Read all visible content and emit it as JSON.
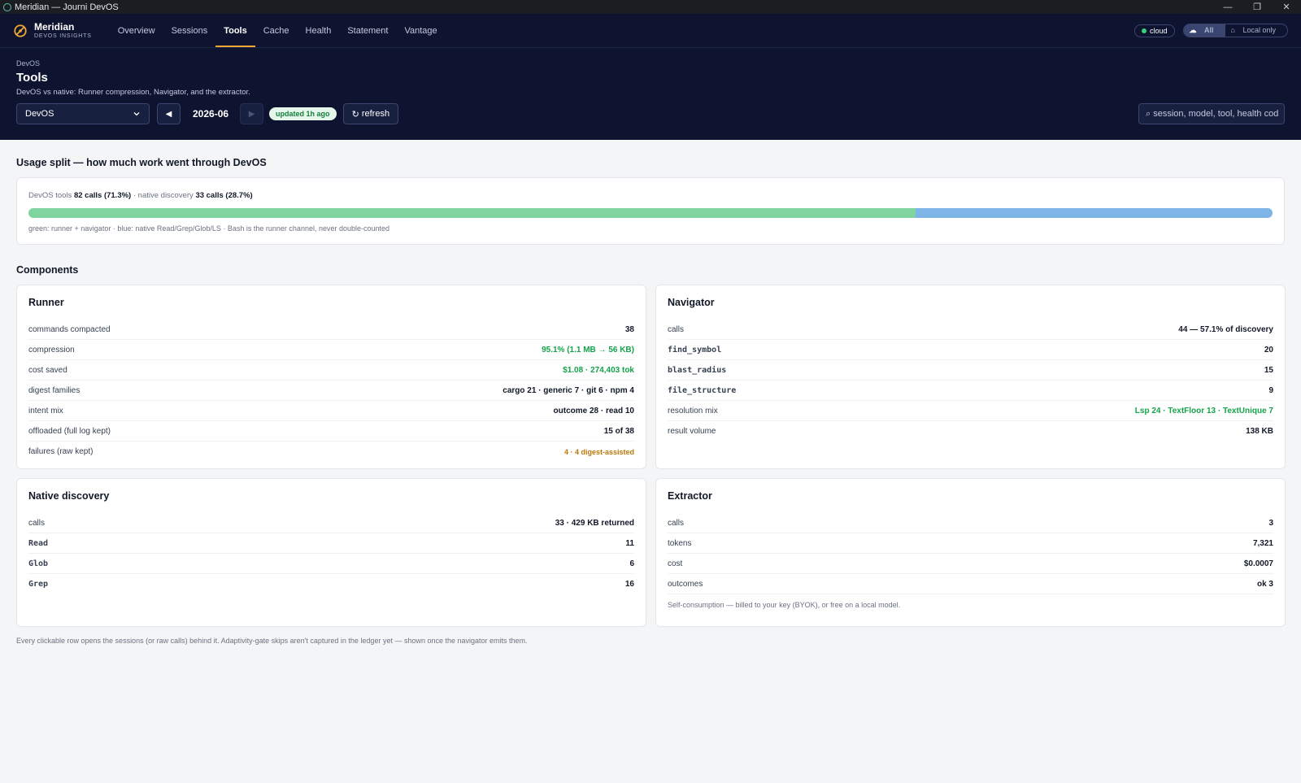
{
  "window": {
    "title": "Meridian — Journi DevOS",
    "controls": [
      "—",
      "❐",
      "✕"
    ]
  },
  "brand": {
    "name": "Meridian",
    "sub": "DEVOS INSIGHTS"
  },
  "nav": {
    "tabs": [
      "Overview",
      "Sessions",
      "Tools",
      "Cache",
      "Health",
      "Statement",
      "Vantage"
    ],
    "active": "Tools",
    "cloud_label": "cloud",
    "scope": {
      "all": "All",
      "local": "Local only"
    }
  },
  "page": {
    "breadcrumb": "DevOS",
    "title": "Tools",
    "subtitle": "DevOS vs native: Runner compression, Navigator, and the extractor.",
    "selector_value": "DevOS",
    "month": "2026-06",
    "updated": "updated 1h ago",
    "refresh": "refresh",
    "search_placeholder": "session, model, tool, health cod"
  },
  "usage": {
    "title": "Usage split — how much work went through DevOS",
    "devos_label": "DevOS tools",
    "devos_value": "82 calls (71.3%)",
    "sep": " · ",
    "native_label": "native discovery",
    "native_value": "33 calls (28.7%)",
    "devos_fraction": 0.713,
    "native_fraction": 0.287,
    "legend": "green: runner + navigator · blue: native Read/Grep/Glob/LS · Bash is the runner channel, never double-counted",
    "colors": {
      "devos": "#7fd4a0",
      "native": "#7cb5e6"
    }
  },
  "components": {
    "title": "Components",
    "runner": {
      "title": "Runner",
      "rows": [
        {
          "label": "commands compacted",
          "value": "38"
        },
        {
          "label": "compression",
          "value": "95.1% (1.1 MB → 56 KB)"
        },
        {
          "label": "cost saved",
          "value": "$1.08 · 274,403 tok"
        },
        {
          "label": "digest families",
          "value": "cargo 21 · generic 7 · git 6 · npm 4"
        },
        {
          "label": "intent mix",
          "value": "outcome 28 · read 10"
        },
        {
          "label": "offloaded (full log kept)",
          "value": "15 of 38"
        },
        {
          "label": "failures (raw kept)",
          "value": "4 · 4 digest-assisted"
        }
      ]
    },
    "navigator": {
      "title": "Navigator",
      "rows": [
        {
          "label": "calls",
          "value": "44 — 57.1% of discovery"
        },
        {
          "label": "find_symbol",
          "value": "20"
        },
        {
          "label": "blast_radius",
          "value": "15"
        },
        {
          "label": "file_structure",
          "value": "9"
        },
        {
          "label": "resolution mix",
          "value": "Lsp 24 · TextFloor 13 · TextUnique 7"
        },
        {
          "label": "result volume",
          "value": "138 KB"
        }
      ]
    },
    "native": {
      "title": "Native discovery",
      "rows": [
        {
          "label": "calls",
          "value": "33 · 429 KB returned"
        },
        {
          "label": "Read",
          "value": "11"
        },
        {
          "label": "Glob",
          "value": "6"
        },
        {
          "label": "Grep",
          "value": "16"
        }
      ]
    },
    "extractor": {
      "title": "Extractor",
      "rows": [
        {
          "label": "calls",
          "value": "3"
        },
        {
          "label": "tokens",
          "value": "7,321"
        },
        {
          "label": "cost",
          "value": "$0.0007"
        },
        {
          "label": "outcomes",
          "value": "ok 3"
        }
      ],
      "note": "Self-consumption — billed to your key (BYOK), or free on a local model."
    }
  },
  "footnote": "Every clickable row opens the sessions (or raw calls) behind it. Adaptivity-gate skips aren't captured in the ledger yet — shown once the navigator emits them."
}
